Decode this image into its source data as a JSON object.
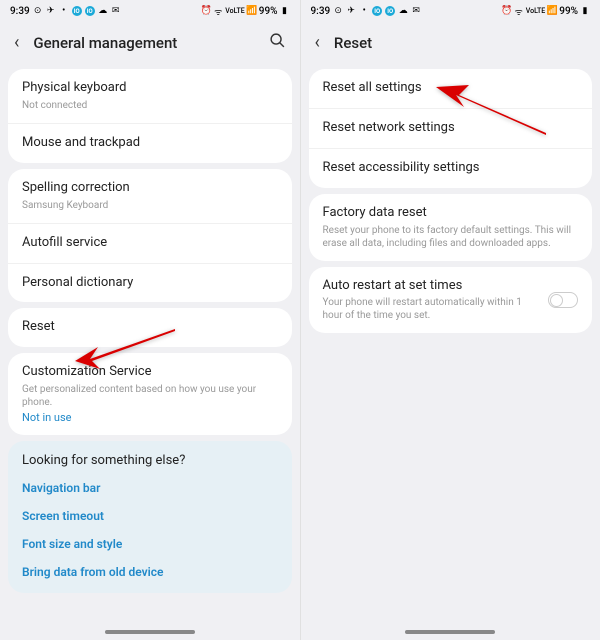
{
  "status": {
    "time": "9:39",
    "battery": "99%",
    "network": "VoLTE"
  },
  "left": {
    "title": "General management",
    "items": {
      "physical_keyboard": "Physical keyboard",
      "physical_keyboard_sub": "Not connected",
      "mouse_trackpad": "Mouse and trackpad",
      "spelling": "Spelling correction",
      "spelling_sub": "Samsung Keyboard",
      "autofill": "Autofill service",
      "dictionary": "Personal dictionary",
      "reset": "Reset",
      "customization": "Customization Service",
      "customization_sub": "Get personalized content based on how you use your phone.",
      "customization_link": "Not in use"
    },
    "help": {
      "title": "Looking for something else?",
      "links": {
        "nav": "Navigation bar",
        "timeout": "Screen timeout",
        "font": "Font size and style",
        "bring": "Bring data from old device"
      }
    }
  },
  "right": {
    "title": "Reset",
    "items": {
      "reset_all": "Reset all settings",
      "reset_network": "Reset network settings",
      "reset_accessibility": "Reset accessibility settings",
      "factory": "Factory data reset",
      "factory_sub": "Reset your phone to its factory default settings. This will erase all data, including files and downloaded apps.",
      "auto_restart": "Auto restart at set times",
      "auto_restart_sub": "Your phone will restart automatically within 1 hour of the time you set."
    }
  }
}
